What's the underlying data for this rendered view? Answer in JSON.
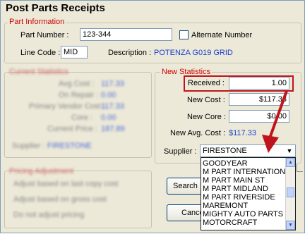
{
  "window": {
    "title": "Post Parts Receipts"
  },
  "part_info": {
    "legend": "Part Information",
    "part_number_label": "Part Number :",
    "part_number_value": "123-344",
    "alternate_number_label": "Alternate Number",
    "line_code_label": "Line Code :",
    "line_code_value": "MID",
    "description_label": "Description :",
    "description_value": "POTENZA G019 GRID"
  },
  "current_stats_blurred": {
    "legend": "Current Statistics",
    "rows": [
      {
        "label": "Avg Cost :",
        "value": "117.33"
      },
      {
        "label": "On Repair :",
        "value": "0.00"
      },
      {
        "label": "Primary Vendor Cost :",
        "value": "117.33"
      },
      {
        "label": "Core :",
        "value": "0.00"
      },
      {
        "label": "Current Price :",
        "value": "187.89"
      }
    ],
    "supplier_label": "Supplier :",
    "supplier_value": "FIRESTONE"
  },
  "pricing_blurred": {
    "legend": "Pricing Adjustment",
    "options": [
      "Adjust based on last copy cost",
      "Adjust based on gross cost",
      "Do not adjust pricing"
    ]
  },
  "new_stats": {
    "legend": "New Statistics",
    "received_label": "Received :",
    "received_value": "1.00",
    "new_cost_label": "New Cost :",
    "new_cost_value": "$117.33",
    "new_core_label": "New Core :",
    "new_core_value": "$0.00",
    "new_avg_cost_label": "New Avg. Cost :",
    "new_avg_cost_value": "$117.33",
    "supplier_label": "Supplier :",
    "supplier_value": "FIRESTONE"
  },
  "buttons": {
    "search": "Search",
    "cancel": "Cance"
  },
  "supplier_list": {
    "items": [
      "GOODYEAR",
      "M PART INTERNATION",
      "M PART MAIN ST",
      "M PART MIDLAND",
      "M PART RIVERSIDE",
      "MAREMONT",
      "MIGHTY AUTO PARTS",
      "MOTORCRAFT"
    ]
  },
  "colors": {
    "highlight_red": "#c0141c",
    "label_blue": "#1a3fcc",
    "legend_red": "#cc0000"
  }
}
